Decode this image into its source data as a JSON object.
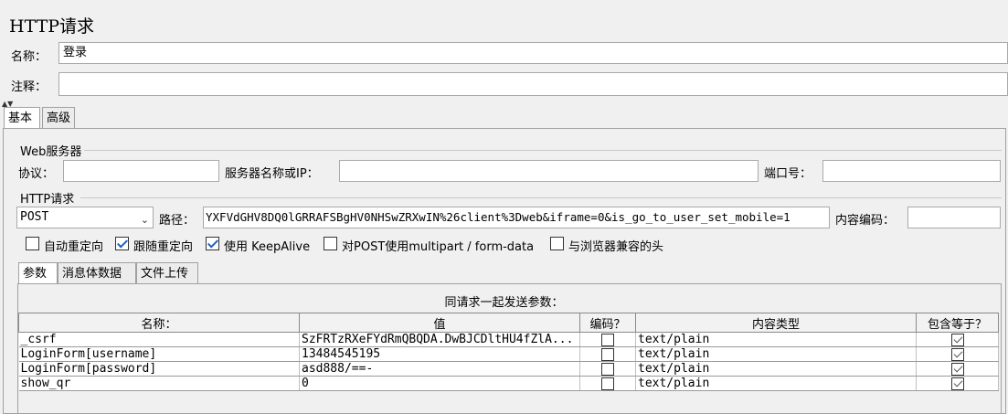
{
  "title": "HTTP请求",
  "name_label": "名称：",
  "name_value": "登录",
  "comment_label": "注释：",
  "comment_value": "",
  "tabs": [
    "基本",
    "高级"
  ],
  "web_server": {
    "group_title": "Web服务器",
    "protocol_label": "协议：",
    "protocol_value": "",
    "server_label": "服务器名称或IP：",
    "server_value": "",
    "port_label": "端口号：",
    "port_value": ""
  },
  "http_request": {
    "group_title": "HTTP请求",
    "method": "POST",
    "path_label": "路径：",
    "path_value": "YXFVdGHV8DQ0lGRRAFSBgHV0NHSwZRXwIN%26client%3Dweb&iframe=0&is_go_to_user_set_mobile=1",
    "encoding_label": "内容编码：",
    "encoding_value": ""
  },
  "options": [
    {
      "label": "自动重定向",
      "checked": false
    },
    {
      "label": "跟随重定向",
      "checked": true
    },
    {
      "label": "使用 KeepAlive",
      "checked": true
    },
    {
      "label": "对POST使用multipart / form-data",
      "checked": false
    },
    {
      "label": "与浏览器兼容的头",
      "checked": false
    }
  ],
  "sub_tabs": [
    "参数",
    "消息体数据",
    "文件上传"
  ],
  "params_caption": "同请求一起发送参数：",
  "columns": [
    "名称：",
    "值",
    "编码？",
    "内容类型",
    "包含等于？"
  ],
  "params": [
    {
      "name": "_csrf",
      "value": "SzFRTzRXeFYdRmQBQDA.DwBJCDltHU4fZlA...",
      "encode": false,
      "content_type": "text/plain",
      "include_equals": true
    },
    {
      "name": "LoginForm[username]",
      "value": "13484545195",
      "encode": false,
      "content_type": "text/plain",
      "include_equals": true
    },
    {
      "name": "LoginForm[password]",
      "value": "asd888/==-",
      "encode": false,
      "content_type": "text/plain",
      "include_equals": true
    },
    {
      "name": "show_qr",
      "value": "0",
      "encode": false,
      "content_type": "text/plain",
      "include_equals": true
    }
  ]
}
